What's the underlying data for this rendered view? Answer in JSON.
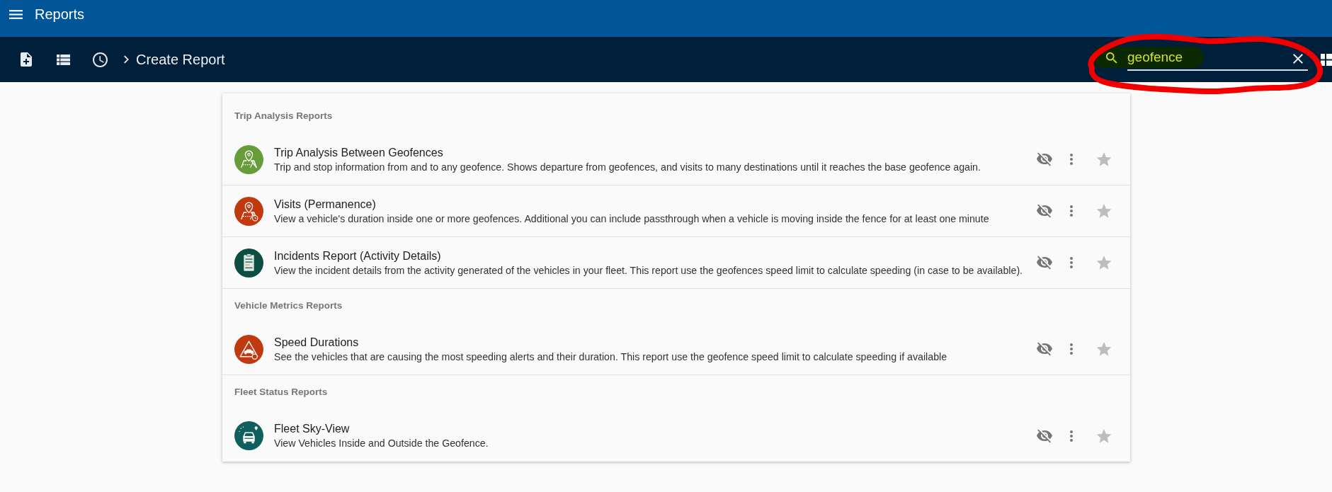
{
  "app_bar": {
    "title": "Reports"
  },
  "toolbar": {
    "breadcrumb": "Create Report",
    "search": {
      "value": "geofence"
    }
  },
  "sections": [
    {
      "title": "Trip Analysis Reports",
      "reports": [
        {
          "kind": "map",
          "color": "#679c3a",
          "title": "Trip Analysis Between Geofences",
          "description": "Trip and stop information from and to any geofence. Shows departure from geofences, and visits to many destinations until it reaches the base geofence again.",
          "favorite": false
        },
        {
          "kind": "map-clock",
          "color": "#c0390f",
          "title": "Visits (Permanence)",
          "description": "View a vehicle's duration inside one or more geofences. Additional you can include passthrough when a vehicle is moving inside the fence for at least one minute",
          "favorite": false
        },
        {
          "kind": "clipboard",
          "color": "#0e4d42",
          "title": "Incidents Report (Activity Details)",
          "description": "View the incident details from the activity generated of the vehicles in your fleet. This report use the geofences speed limit to calculate speeding (in case to be available).",
          "favorite": false
        }
      ]
    },
    {
      "title": "Vehicle Metrics Reports",
      "reports": [
        {
          "kind": "speed",
          "color": "#c0390f",
          "title": "Speed Durations",
          "description": "See the vehicles that are causing the most speeding alerts and their duration. This report use the geofence speed limit to calculate speeding if available",
          "favorite": false
        }
      ]
    },
    {
      "title": "Fleet Status Reports",
      "reports": [
        {
          "kind": "car",
          "color": "#0f5f5e",
          "title": "Fleet Sky-View",
          "description": "View Vehicles Inside and Outside the Geofence.",
          "favorite": false
        }
      ]
    }
  ]
}
